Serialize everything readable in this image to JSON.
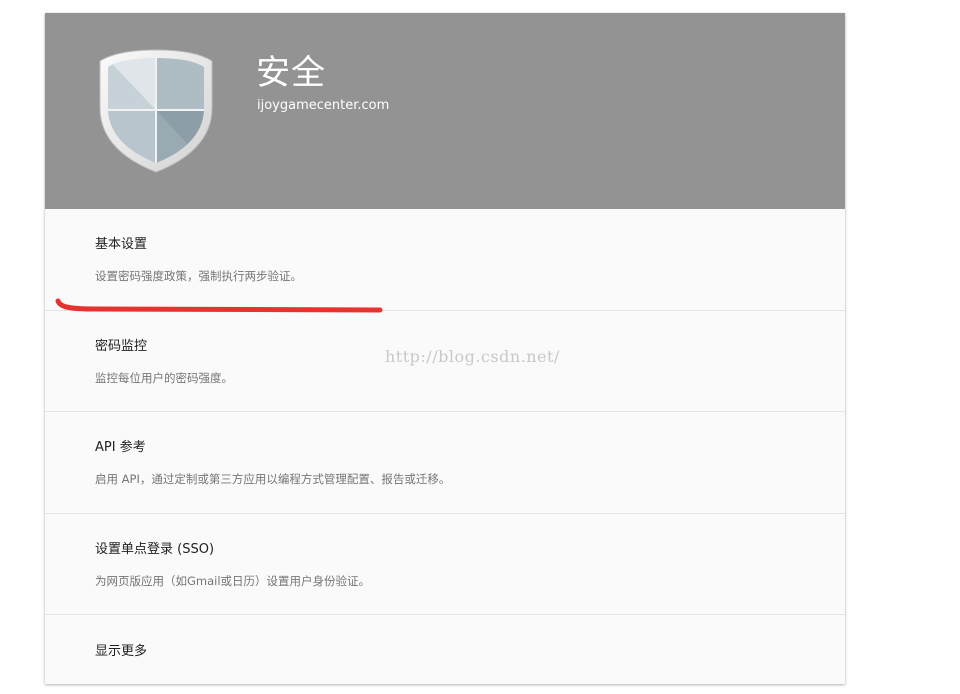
{
  "header": {
    "title": "安全",
    "subtitle": "ijoygamecenter.com",
    "icon": "shield-icon",
    "background_color": "#939393"
  },
  "settings": [
    {
      "title": "基本设置",
      "description": "设置密码强度政策，强制执行两步验证。"
    },
    {
      "title": "密码监控",
      "description": "监控每位用户的密码强度。"
    },
    {
      "title": "API 参考",
      "description": "启用 API，通过定制或第三方应用以编程方式管理配置、报告或迁移。"
    },
    {
      "title": "设置单点登录 (SSO)",
      "description": "为网页版应用（如Gmail或日历）设置用户身份验证。"
    },
    {
      "title": "显示更多"
    }
  ],
  "watermark": "http://blog.csdn.net/",
  "annotation_color": "#e8322f"
}
